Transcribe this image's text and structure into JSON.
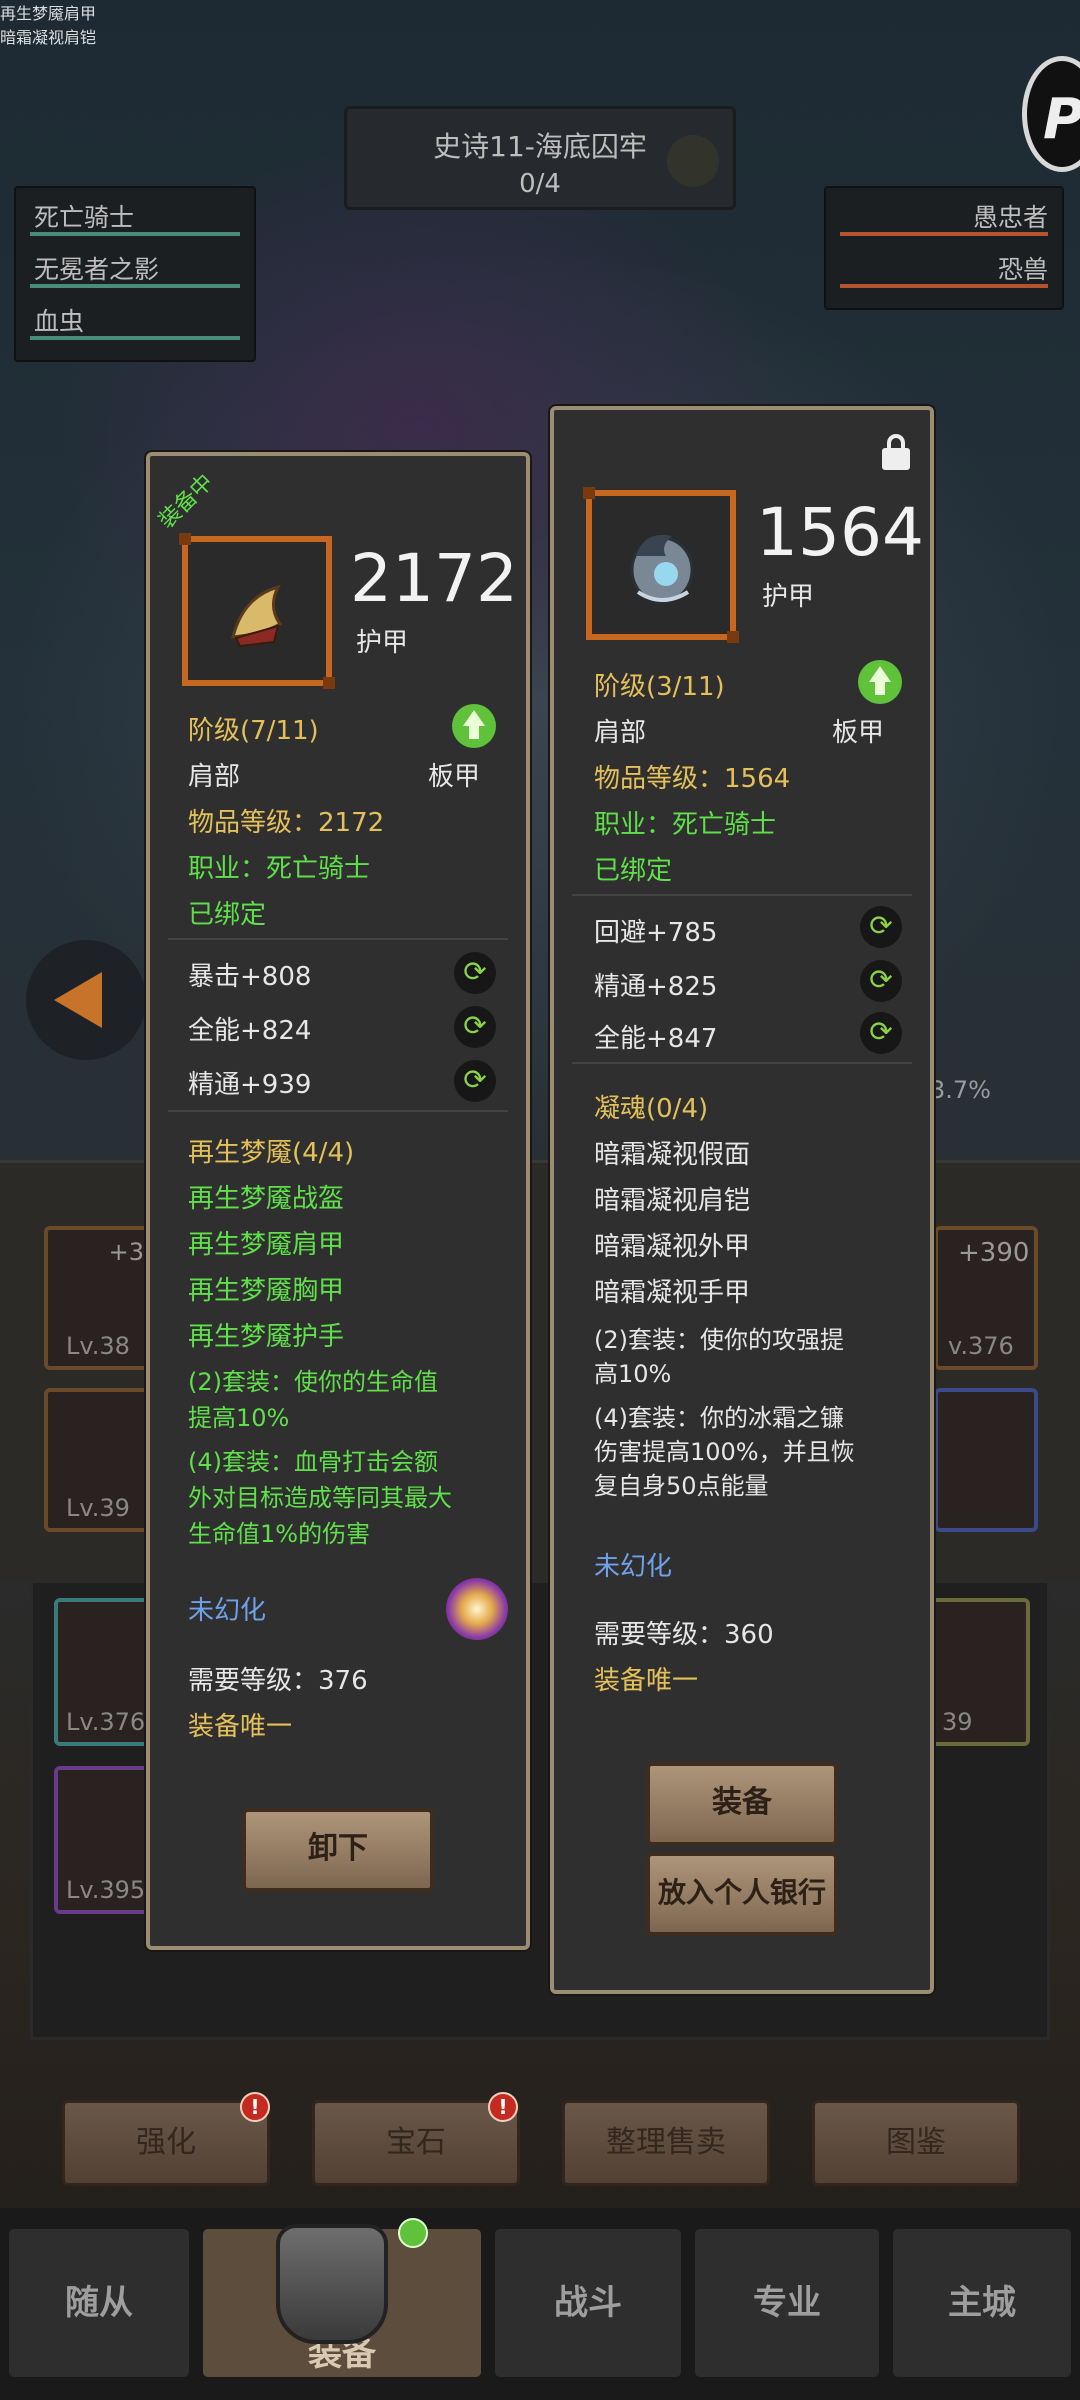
{
  "stage": {
    "title": "史诗11-海底囚牢",
    "progress": "0/4"
  },
  "bosses_left": [
    {
      "name": "死亡骑士",
      "bar_color": "#4a8c7a"
    },
    {
      "name": "无冕者之影",
      "bar_color": "#4a8c7a"
    },
    {
      "name": "血虫",
      "bar_color": "#4a8c7a"
    }
  ],
  "bosses_right": [
    {
      "name": "愚忠者",
      "bar_color": "#b5532e"
    },
    {
      "name": "恐兽",
      "bar_color": "#b5532e"
    }
  ],
  "bg": {
    "slot_levels": [
      "Lv.38",
      "Lv.39",
      "Lv.376",
      "Lv.395",
      "v.376",
      "39"
    ],
    "slot_plus": [
      "+3",
      "+390"
    ],
    "percent": "3.7%"
  },
  "actions": [
    "强化",
    "宝石",
    "整理售卖",
    "图鉴"
  ],
  "nav": [
    "随从",
    "装备",
    "战斗",
    "专业",
    "主城"
  ],
  "equipped": {
    "ribbon": "装备中",
    "name": "再生梦魇肩甲",
    "armor_value": "2172",
    "armor_label": "护甲",
    "tier": "阶级(7/11)",
    "slot": "肩部",
    "type": "板甲",
    "item_level": "物品等级：2172",
    "class": "职业：死亡骑士",
    "bound": "已绑定",
    "stats": [
      "暴击+808",
      "全能+824",
      "精通+939"
    ],
    "set_title": "再生梦魇(4/4)",
    "set_items": [
      "再生梦魇战盔",
      "再生梦魇肩甲",
      "再生梦魇胸甲",
      "再生梦魇护手"
    ],
    "set_bonus_2": [
      "(2)套装：使你的生命值",
      "提高10%"
    ],
    "set_bonus_4": [
      "(4)套装：血骨打击会额",
      "外对目标造成等同其最大",
      "生命值1%的伤害"
    ],
    "transmog": "未幻化",
    "req_level": "需要等级：376",
    "unique": "装备唯一",
    "button": "卸下"
  },
  "compare": {
    "name": "暗霜凝视肩铠",
    "armor_value": "1564",
    "armor_label": "护甲",
    "tier": "阶级(3/11)",
    "slot": "肩部",
    "type": "板甲",
    "item_level": "物品等级：1564",
    "class": "职业：死亡骑士",
    "bound": "已绑定",
    "stats": [
      "回避+785",
      "精通+825",
      "全能+847"
    ],
    "set_title": "凝魂(0/4)",
    "set_items": [
      "暗霜凝视假面",
      "暗霜凝视肩铠",
      "暗霜凝视外甲",
      "暗霜凝视手甲"
    ],
    "set_bonus_2": [
      "(2)套装：使你的攻强提",
      "高10%"
    ],
    "set_bonus_4": [
      "(4)套装：你的冰霜之镰",
      "伤害提高100%，并且恢",
      "复自身50点能量"
    ],
    "transmog": "未幻化",
    "req_level": "需要等级：360",
    "unique": "装备唯一",
    "buttons": [
      "装备",
      "放入个人银行"
    ]
  },
  "colors": {
    "name_red": "#e2513d",
    "yellow": "#e3c05a",
    "green": "#5fe04a",
    "blue": "#6fa0e8"
  }
}
